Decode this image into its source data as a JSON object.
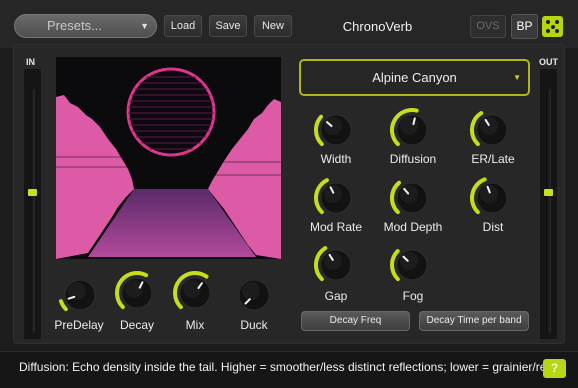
{
  "header": {
    "presets_label": "Presets...",
    "load_label": "Load",
    "save_label": "Save",
    "new_label": "New",
    "plugin_title": "ChronoVerb",
    "ovs_label": "OVS",
    "bp_label": "BP",
    "randomize_icon": "dice-icon"
  },
  "meters": {
    "in_label": "IN",
    "out_label": "OUT",
    "in_level": 0.0,
    "out_level": 0.0
  },
  "ir_selector": {
    "value": "Alpine Canyon"
  },
  "knobs": {
    "predelay": {
      "label": "PreDelay",
      "value": 0.1
    },
    "decay": {
      "label": "Decay",
      "value": 0.6
    },
    "mix": {
      "label": "Mix",
      "value": 0.63
    },
    "duck": {
      "label": "Duck",
      "value": 0.0
    },
    "width": {
      "label": "Width",
      "value": 0.32
    },
    "diffusion": {
      "label": "Diffusion",
      "value": 0.55
    },
    "er_late": {
      "label": "ER/Late",
      "value": 0.38
    },
    "mod_rate": {
      "label": "Mod Rate",
      "value": 0.4
    },
    "mod_depth": {
      "label": "Mod Depth",
      "value": 0.35
    },
    "dist": {
      "label": "Dist",
      "value": 0.42
    },
    "gap": {
      "label": "Gap",
      "value": 0.38
    },
    "fog": {
      "label": "Fog",
      "value": 0.33
    }
  },
  "buttons": {
    "decay_freq": "Decay Freq",
    "decay_time_per_band": "Decay Time per band"
  },
  "status": {
    "text": "Diffusion: Echo density inside the tail. Higher = smoother/less distinct reflections; lower = grainier/retro.",
    "help_label": "?"
  },
  "colors": {
    "accent": "#c8dd1a",
    "visual_pink": "#e05aa8",
    "visual_sun": "#e2328a",
    "background": "#1d1d1d"
  }
}
